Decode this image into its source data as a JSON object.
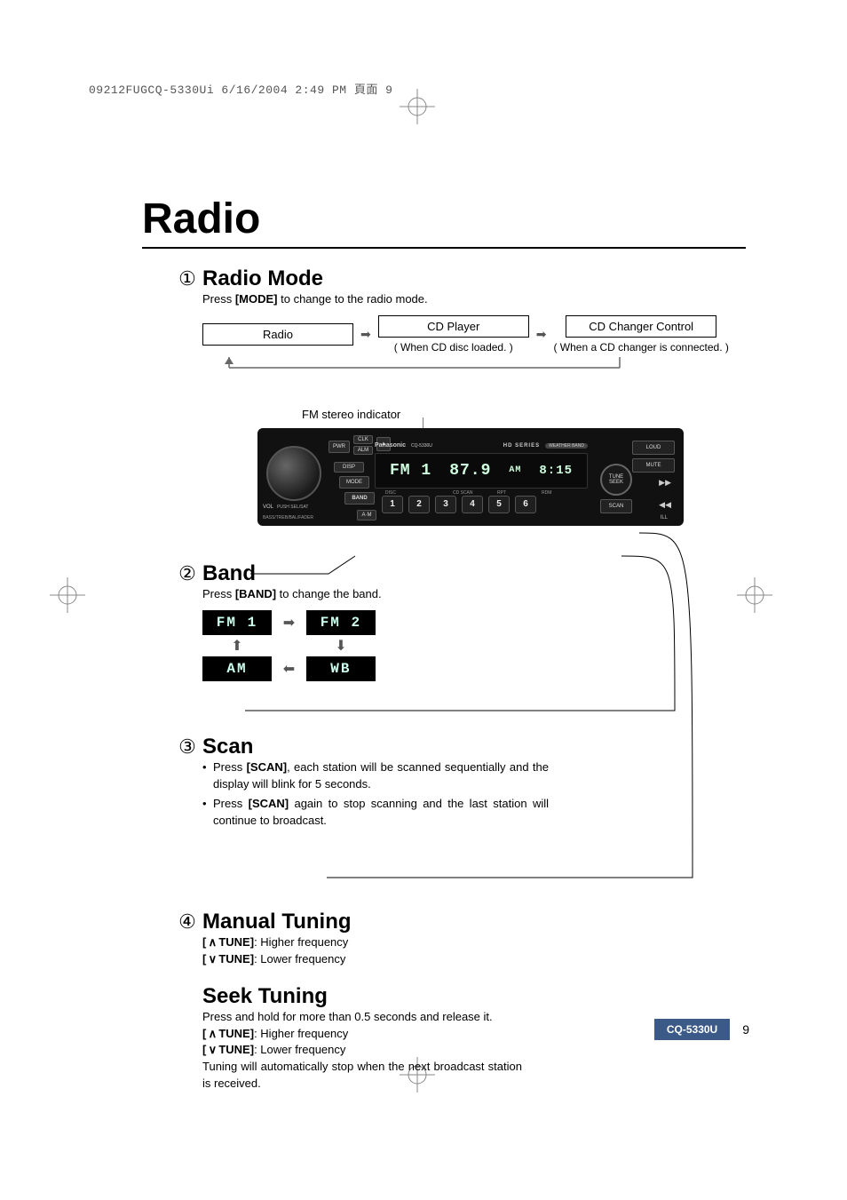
{
  "doc": {
    "header_line": "09212FUGCQ-5330Ui 6/16/2004 2:49 PM  頁面 9",
    "title": "Radio",
    "page_number": "9",
    "footer_model": "CQ-5330U"
  },
  "section1": {
    "num": "①",
    "title": "Radio Mode",
    "desc_pre": "Press ",
    "desc_key": "[MODE]",
    "desc_post": " to change to the radio mode.",
    "flow": {
      "box1": "Radio",
      "box2": "CD Player",
      "note2": "( When CD disc loaded. )",
      "box3": "CD Changer Control",
      "note3": "( When a CD changer is connected. )"
    },
    "indicator_label": "FM stereo indicator"
  },
  "device": {
    "brand": "Panasonic",
    "model": "CQ-5330U",
    "series": "HD SERIES",
    "weather": "WEATHER BAND",
    "knob_label_vol": "VOL",
    "knob_label_push": "PUSH SEL/SAT",
    "knob_sub": "BASS/TREB/BAL/FADER",
    "btn_pwr": "PWR",
    "btn_clk": "CLK",
    "btn_alm": "ALM",
    "btn_eject": "▲",
    "btn_disp": "DISP",
    "btn_mode": "MODE",
    "btn_band": "BAND",
    "btn_am": "A·M",
    "btn_loud": "LOUD",
    "btn_mute": "MUTE",
    "btn_tune": "TUNE",
    "btn_seek": "SEEK",
    "btn_scan": "SCAN",
    "btn_ill": "ILL",
    "label_disc": "DISC",
    "label_cdscan": "CD SCAN",
    "label_rpt": "RPT",
    "label_rdm": "RDM",
    "screen": {
      "band": "FM 1",
      "freq": "87.9",
      "clock_pre": "AM",
      "clock": "8:15"
    },
    "presets": [
      "1",
      "2",
      "3",
      "4",
      "5",
      "6"
    ]
  },
  "section2": {
    "num": "②",
    "title": "Band",
    "desc_pre": "Press ",
    "desc_key": "[BAND]",
    "desc_post": " to change the band.",
    "cells": {
      "fm1": "FM 1",
      "fm2": "FM 2",
      "am": "AM",
      "wb": "WB"
    }
  },
  "section3": {
    "num": "③",
    "title": "Scan",
    "b1_pre": "Press ",
    "b1_key": "[SCAN]",
    "b1_post": ", each station will be scanned sequentially and the display will blink for 5 seconds.",
    "b2_pre": "Press ",
    "b2_key": "[SCAN]",
    "b2_post": " again to stop scanning and the last station will continue to broadcast."
  },
  "section4": {
    "num": "④",
    "title": "Manual Tuning",
    "up_key": "TUNE]",
    "up_txt": ": Higher frequency",
    "dn_key": "TUNE]",
    "dn_txt": ": Lower frequency"
  },
  "section5": {
    "title": "Seek Tuning",
    "desc": "Press and hold for more than 0.5 seconds and release it.",
    "up_key": "TUNE]",
    "up_txt": ": Higher frequency",
    "dn_key": "TUNE]",
    "dn_txt": ": Lower frequency",
    "note": "Tuning will automatically stop when the next broadcast station is received."
  }
}
